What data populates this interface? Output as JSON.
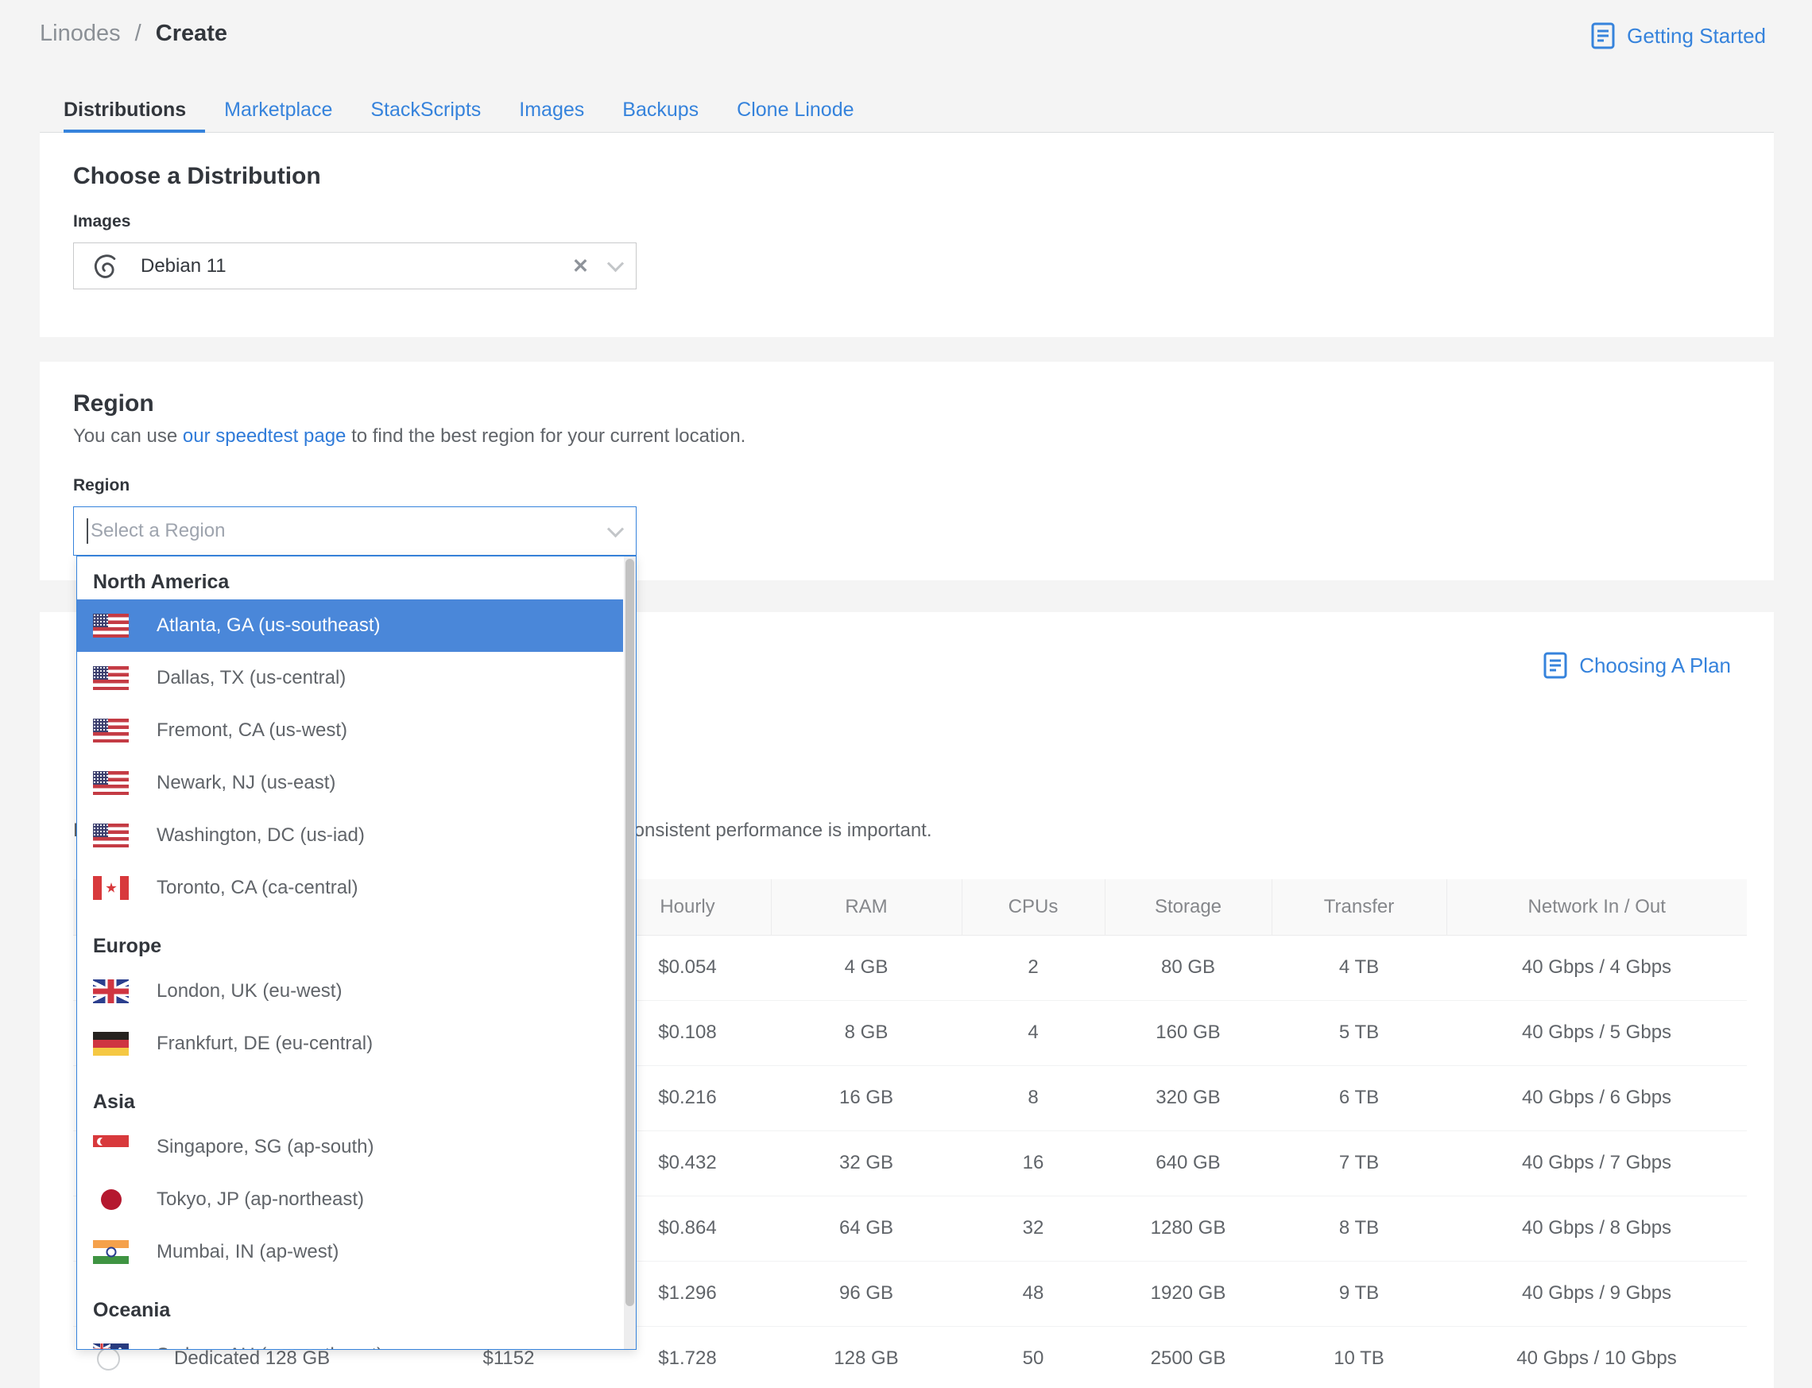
{
  "colors": {
    "accent_blue": "#3683dc",
    "selected_option_bg": "#4a87d9",
    "active_tab_text": "#32363c",
    "page_bg": "#f4f4f4"
  },
  "header": {
    "breadcrumb": {
      "root": "Linodes",
      "separator": "/",
      "current": "Create"
    },
    "getting_started_label": "Getting Started"
  },
  "tabs": [
    {
      "label": "Distributions",
      "active": true
    },
    {
      "label": "Marketplace",
      "active": false
    },
    {
      "label": "StackScripts",
      "active": false
    },
    {
      "label": "Images",
      "active": false
    },
    {
      "label": "Backups",
      "active": false
    },
    {
      "label": "Clone Linode",
      "active": false
    }
  ],
  "distribution": {
    "heading": "Choose a Distribution",
    "images_label": "Images",
    "selected_image": "Debian 11",
    "clear_icon": "✕"
  },
  "region": {
    "heading": "Region",
    "description_prefix": "You can use ",
    "description_link": "our speedtest page",
    "description_suffix": " to find the best region for your current location.",
    "label": "Region",
    "placeholder": "Select a Region"
  },
  "region_dropdown": {
    "groups": [
      {
        "name": "North America",
        "items": [
          {
            "label": "Atlanta, GA (us-southeast)",
            "flag": "us",
            "selected": true
          },
          {
            "label": "Dallas, TX (us-central)",
            "flag": "us",
            "selected": false
          },
          {
            "label": "Fremont, CA (us-west)",
            "flag": "us",
            "selected": false
          },
          {
            "label": "Newark, NJ (us-east)",
            "flag": "us",
            "selected": false
          },
          {
            "label": "Washington, DC (us-iad)",
            "flag": "us",
            "selected": false
          },
          {
            "label": "Toronto, CA (ca-central)",
            "flag": "ca",
            "selected": false
          }
        ]
      },
      {
        "name": "Europe",
        "items": [
          {
            "label": "London, UK (eu-west)",
            "flag": "uk",
            "selected": false
          },
          {
            "label": "Frankfurt, DE (eu-central)",
            "flag": "de",
            "selected": false
          }
        ]
      },
      {
        "name": "Asia",
        "items": [
          {
            "label": "Singapore, SG (ap-south)",
            "flag": "sg",
            "selected": false
          },
          {
            "label": "Tokyo, JP (ap-northeast)",
            "flag": "jp",
            "selected": false
          },
          {
            "label": "Mumbai, IN (ap-west)",
            "flag": "in",
            "selected": false
          }
        ]
      },
      {
        "name": "Oceania",
        "items": [
          {
            "label": "Sydney, AU (ap-southeast)",
            "flag": "au",
            "selected": false
          }
        ]
      }
    ]
  },
  "plan": {
    "choosing_link_label": "Choosing A Plan",
    "description": "Dedicated CPU instances are good for full-duty workloads where consistent performance is important."
  },
  "plan_table": {
    "headers": [
      "",
      "",
      "Hourly",
      "RAM",
      "CPUs",
      "Storage",
      "Transfer",
      "Network In / Out"
    ],
    "rows": [
      {
        "radio": false,
        "plan": "",
        "monthly": "",
        "hourly": "$0.054",
        "ram": "4 GB",
        "cpus": "2",
        "storage": "80 GB",
        "transfer": "4 TB",
        "network": "40 Gbps / 4 Gbps"
      },
      {
        "radio": false,
        "plan": "",
        "monthly": "",
        "hourly": "$0.108",
        "ram": "8 GB",
        "cpus": "4",
        "storage": "160 GB",
        "transfer": "5 TB",
        "network": "40 Gbps / 5 Gbps"
      },
      {
        "radio": false,
        "plan": "",
        "monthly": "",
        "hourly": "$0.216",
        "ram": "16 GB",
        "cpus": "8",
        "storage": "320 GB",
        "transfer": "6 TB",
        "network": "40 Gbps / 6 Gbps"
      },
      {
        "radio": false,
        "plan": "",
        "monthly": "",
        "hourly": "$0.432",
        "ram": "32 GB",
        "cpus": "16",
        "storage": "640 GB",
        "transfer": "7 TB",
        "network": "40 Gbps / 7 Gbps"
      },
      {
        "radio": false,
        "plan": "",
        "monthly": "",
        "hourly": "$0.864",
        "ram": "64 GB",
        "cpus": "32",
        "storage": "1280 GB",
        "transfer": "8 TB",
        "network": "40 Gbps / 8 Gbps"
      },
      {
        "radio": false,
        "plan": "",
        "monthly": "",
        "hourly": "$1.296",
        "ram": "96 GB",
        "cpus": "48",
        "storage": "1920 GB",
        "transfer": "9 TB",
        "network": "40 Gbps / 9 Gbps"
      },
      {
        "radio": true,
        "plan": "Dedicated 128 GB",
        "monthly": "$1152",
        "hourly": "$1.728",
        "ram": "128 GB",
        "cpus": "50",
        "storage": "2500 GB",
        "transfer": "10 TB",
        "network": "40 Gbps / 10 Gbps"
      }
    ]
  }
}
